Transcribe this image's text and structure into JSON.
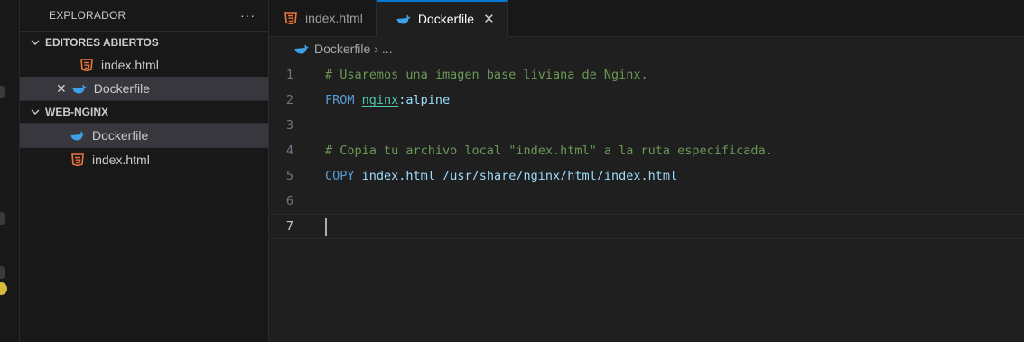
{
  "explorer": {
    "title": "EXPLORADOR",
    "more_label": "···",
    "sections": {
      "open_editors": {
        "label": "EDITORES ABIERTOS",
        "items": [
          {
            "label": "index.html",
            "icon": "html5-icon"
          },
          {
            "label": "Dockerfile",
            "icon": "docker-icon"
          }
        ]
      },
      "project": {
        "label": "WEB-NGINX",
        "items": [
          {
            "label": "Dockerfile",
            "icon": "docker-icon"
          },
          {
            "label": "index.html",
            "icon": "html5-icon"
          }
        ]
      }
    }
  },
  "tabs": [
    {
      "label": "index.html",
      "icon": "html5-icon",
      "active": false
    },
    {
      "label": "Dockerfile",
      "icon": "docker-icon",
      "active": true,
      "close": "✕"
    }
  ],
  "breadcrumb": {
    "file": "Dockerfile",
    "separator": "›",
    "more": "..."
  },
  "code": {
    "lines": [
      {
        "n": "1",
        "text": "# Usaremos una imagen base liviana de Nginx."
      },
      {
        "n": "2",
        "kw": "FROM",
        "img": "nginx",
        "tag": ":alpine"
      },
      {
        "n": "3",
        "text": ""
      },
      {
        "n": "4",
        "text": "# Copia tu archivo local \"index.html\" a la ruta especificada."
      },
      {
        "n": "5",
        "kw": "COPY",
        "args": "index.html /usr/share/nginx/html/index.html"
      },
      {
        "n": "6",
        "text": ""
      },
      {
        "n": "7",
        "text": ""
      }
    ],
    "current_line": "7"
  },
  "colors": {
    "accent": "#0078d4",
    "comment": "#6a9955",
    "keyword": "#569cd6",
    "html_icon": "#e8763a",
    "docker_icon": "#3ea0e8"
  }
}
